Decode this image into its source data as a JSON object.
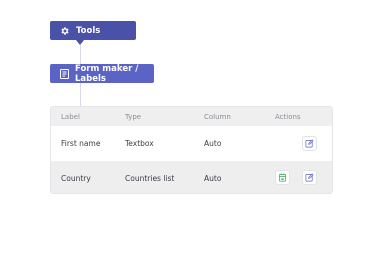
{
  "breadcrumb": {
    "tools_label": "Tools",
    "form_label": "Form maker / Labels"
  },
  "table": {
    "headers": [
      "Label",
      "Type",
      "Column",
      "Actions"
    ],
    "rows": [
      {
        "label": "First name",
        "type": "Textbox",
        "column": "Auto",
        "actions": [
          "edit"
        ]
      },
      {
        "label": "Country",
        "type": "Countries list",
        "column": "Auto",
        "actions": [
          "list",
          "edit"
        ]
      }
    ]
  },
  "icons": {
    "tools": "gear-icon",
    "form": "form-icon",
    "edit": "edit-icon",
    "list": "list-icon"
  },
  "colors": {
    "tools_chip": "#4a51a8",
    "form_chip": "#5b63c4",
    "edit_icon": "#5b63c4",
    "list_icon": "#3aa55a"
  }
}
